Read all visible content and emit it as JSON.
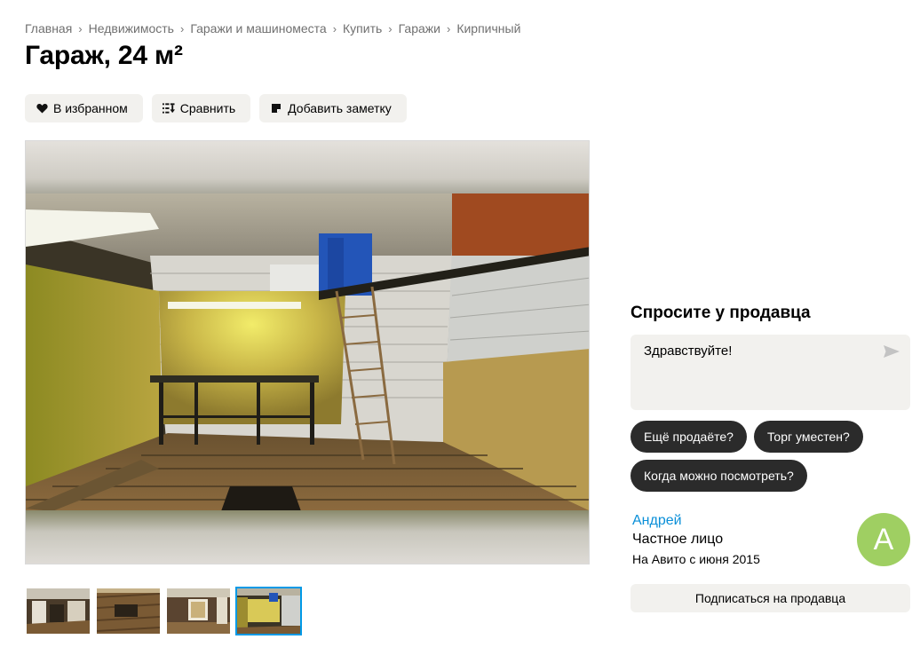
{
  "breadcrumb": [
    "Главная",
    "Недвижимость",
    "Гаражи и машиноместа",
    "Купить",
    "Гаражи",
    "Кирпичный"
  ],
  "breadcrumb_separator": "›",
  "title": "Гараж, 24 м²",
  "actions": {
    "favorite": {
      "label": "В избранном",
      "icon": "heart-icon"
    },
    "compare": {
      "label": "Сравнить",
      "icon": "compare-icon"
    },
    "note": {
      "label": "Добавить заметку",
      "icon": "note-icon"
    }
  },
  "gallery": {
    "thumbnail_count": 4,
    "active_thumbnail": 4
  },
  "ask": {
    "title": "Спросите у продавца",
    "message_value": "Здравствуйте!",
    "send_icon": "send-icon",
    "quick_replies": [
      "Ещё продаёте?",
      "Торг уместен?",
      "Когда можно посмотреть?"
    ]
  },
  "seller": {
    "name": "Андрей",
    "type": "Частное лицо",
    "since": "На Авито с июня 2015",
    "avatar_letter": "А",
    "avatar_color": "#9fcf62"
  },
  "subscribe_label": "Подписаться на продавца",
  "colors": {
    "link": "#0a8fd8",
    "button_bg": "#f2f1ee",
    "chip_bg": "#2b2b2b",
    "thumb_active": "#0099e6"
  }
}
